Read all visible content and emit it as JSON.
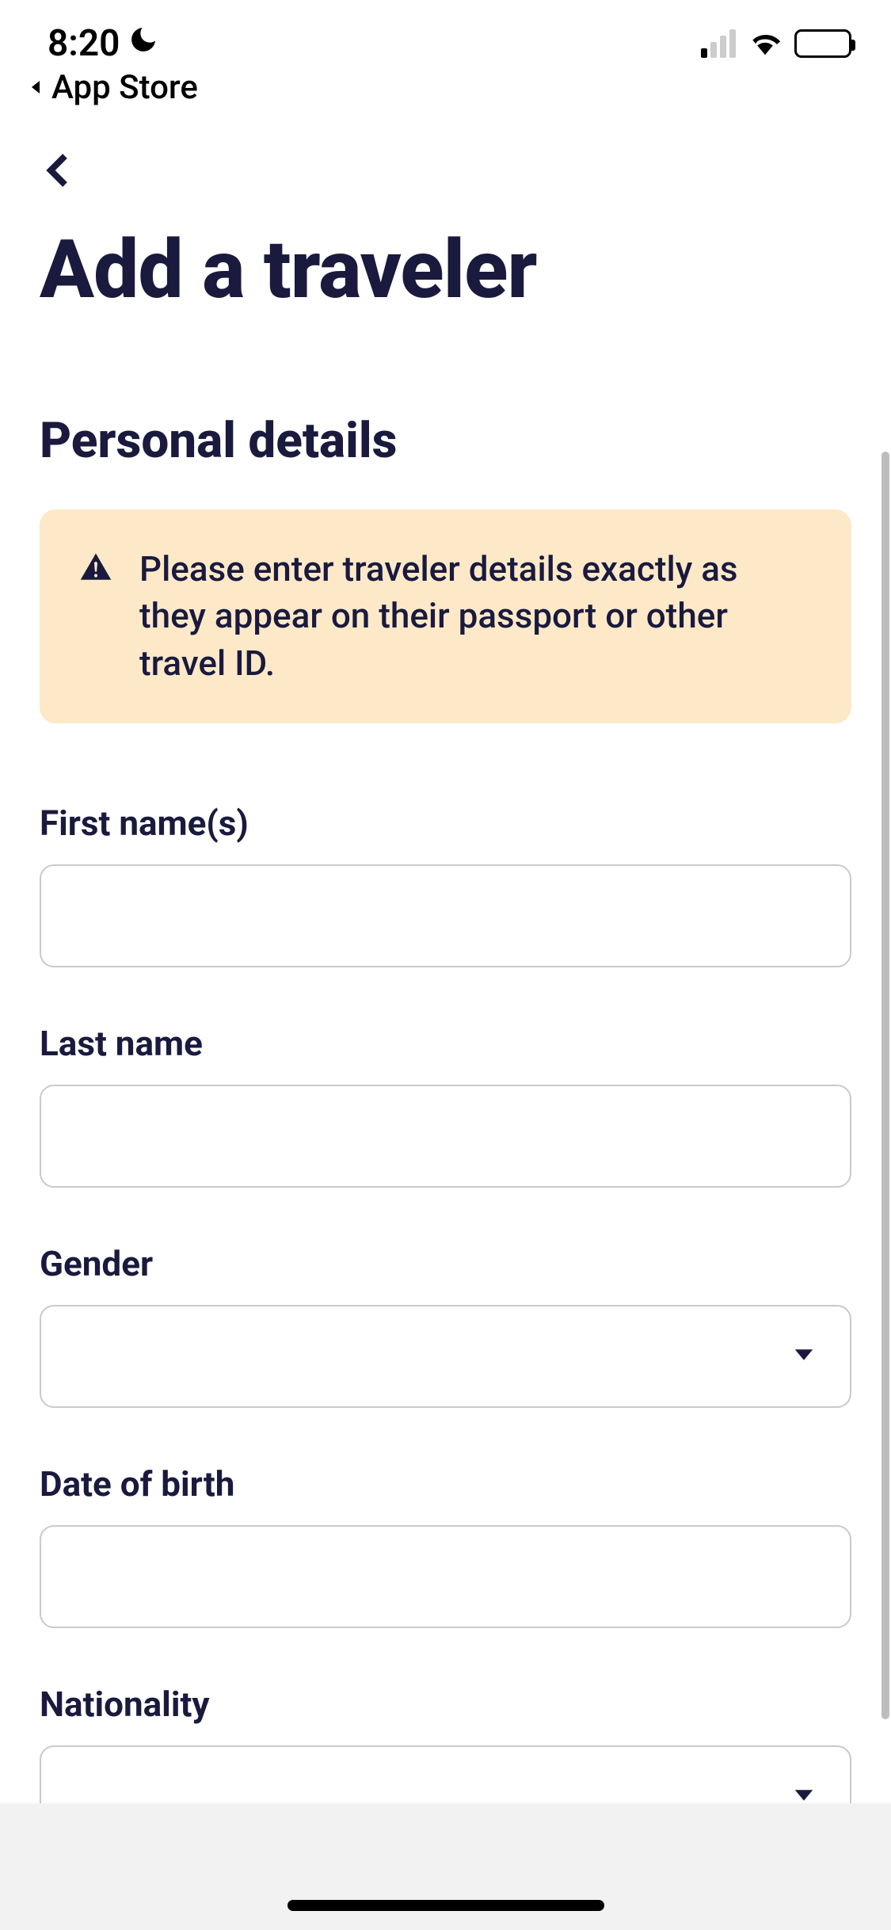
{
  "status": {
    "time": "8:20",
    "breadcrumb": "App Store"
  },
  "page": {
    "title": "Add a traveler",
    "section_title": "Personal details",
    "banner_message": "Please enter traveler details exactly as they appear on their passport or other travel ID."
  },
  "fields": {
    "first_name": {
      "label": "First name(s)",
      "value": ""
    },
    "last_name": {
      "label": "Last name",
      "value": ""
    },
    "gender": {
      "label": "Gender",
      "value": ""
    },
    "dob": {
      "label": "Date of birth",
      "value": ""
    },
    "nationality": {
      "label": "Nationality",
      "value": ""
    }
  }
}
